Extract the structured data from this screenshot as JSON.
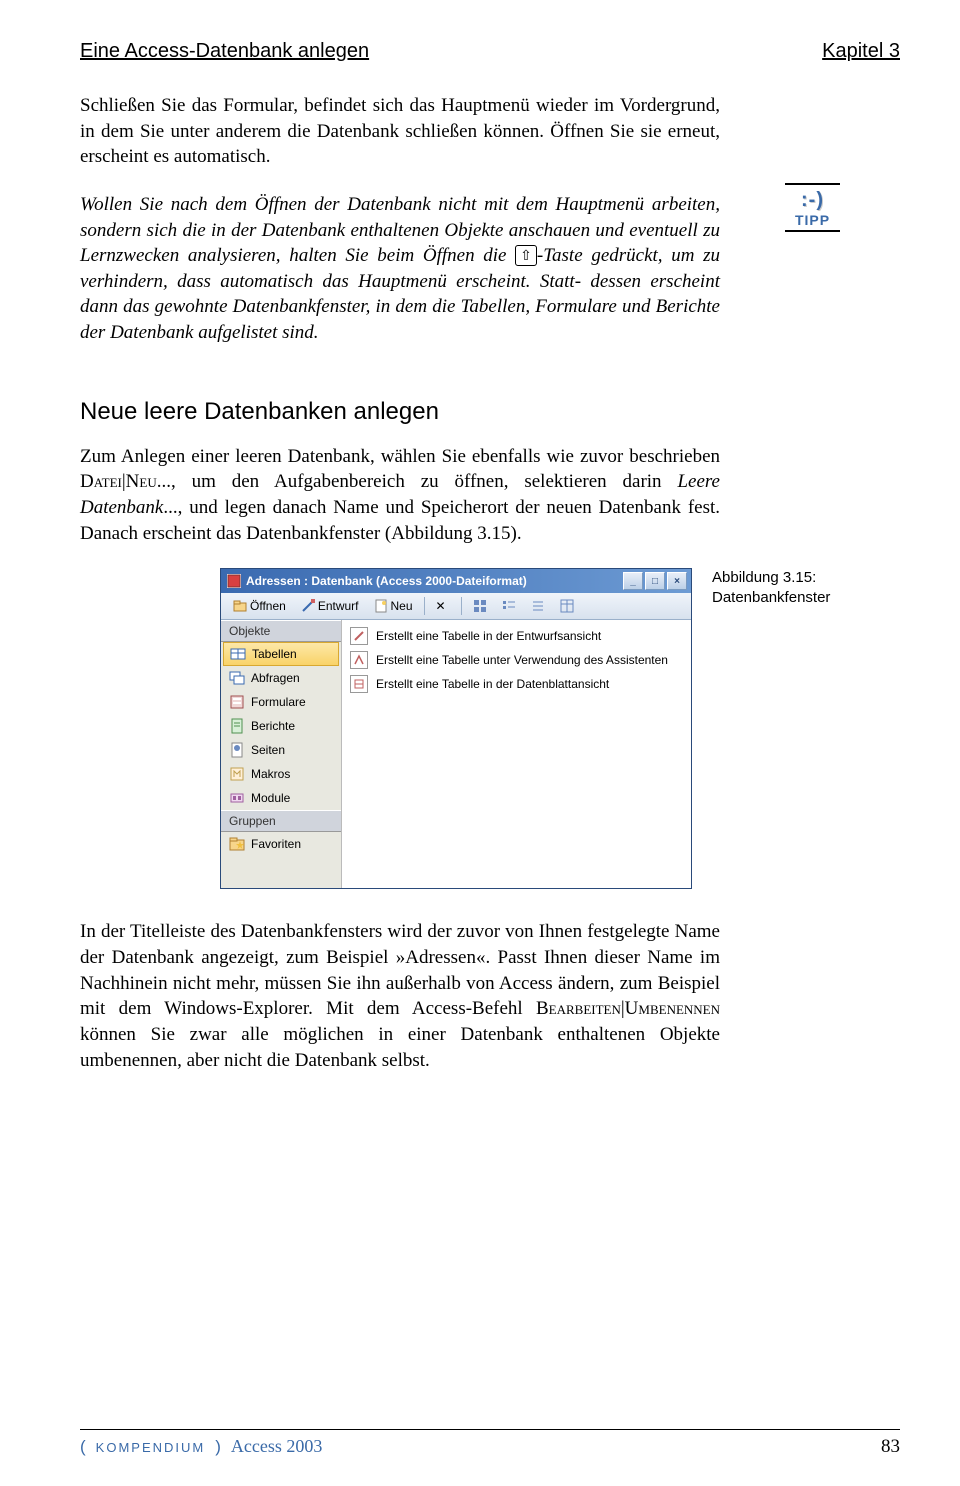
{
  "header": {
    "left": "Eine Access-Datenbank anlegen",
    "right": "Kapitel 3"
  },
  "para1": "Schließen Sie das Formular, befindet sich das Hauptmenü wieder im Vordergrund, in dem Sie unter anderem die Datenbank schließen können. Öffnen Sie sie erneut, erscheint es automatisch.",
  "tipp": {
    "smiley": ":-)",
    "label": "TIPP",
    "text_before": "Wollen Sie nach dem Öffnen der Datenbank nicht mit dem Hauptmenü arbeiten, sondern sich die in der Datenbank enthaltenen Objekte anschauen und eventuell zu Lernzwecken analysieren, halten Sie beim Öffnen die ",
    "key": "⇧",
    "text_after": "-Taste gedrückt, um zu verhindern, dass automatisch das Hauptmenü erscheint. Statt- dessen erscheint dann das gewohnte Datenbankfenster, in dem die Tabellen, Formulare und Berichte der Datenbank aufgelistet sind."
  },
  "subheading": "Neue leere Datenbanken anlegen",
  "para2_a": "Zum Anlegen einer leeren Datenbank, wählen Sie ebenfalls wie zuvor beschrieben ",
  "para2_menu1": "Datei|Neu",
  "para2_b": "..., um den Aufgabenbereich zu öffnen, selektieren darin ",
  "para2_ital": "Leere Datenbank",
  "para2_c": "..., und legen danach Name und Speicherort der neuen Datenbank fest. Danach erscheint das Datenbankfenster (Abbildung 3.15).",
  "figure": {
    "caption_line1": "Abbildung 3.15:",
    "caption_line2": "Datenbankfenster"
  },
  "db_window": {
    "title": "Adressen : Datenbank (Access 2000-Dateiformat)",
    "toolbar": {
      "open": "Öffnen",
      "design": "Entwurf",
      "new": "Neu"
    },
    "sidebar": {
      "group1": "Objekte",
      "items": [
        "Tabellen",
        "Abfragen",
        "Formulare",
        "Berichte",
        "Seiten",
        "Makros",
        "Module"
      ],
      "group2": "Gruppen",
      "favs": "Favoriten"
    },
    "content": [
      "Erstellt eine Tabelle in der Entwurfsansicht",
      "Erstellt eine Tabelle unter Verwendung des Assistenten",
      "Erstellt eine Tabelle in der Datenblattansicht"
    ]
  },
  "para3_a": "In der Titelleiste des Datenbankfensters wird der zuvor von Ihnen festgelegte Name der Datenbank angezeigt, zum Beispiel »Adressen«. Passt Ihnen dieser Name im Nachhinein nicht mehr, müssen Sie ihn außerhalb von Access ändern, zum Beispiel mit dem Windows-Explorer. Mit dem Access-Befehl ",
  "para3_menu": "Bearbeiten|Umbenennen",
  "para3_b": " können Sie zwar alle möglichen in einer Datenbank enthaltenen Objekte umbenennen, aber nicht die Datenbank selbst.",
  "footer": {
    "kompendium": "KOMPENDIUM",
    "product": "Access 2003",
    "page": "83"
  }
}
